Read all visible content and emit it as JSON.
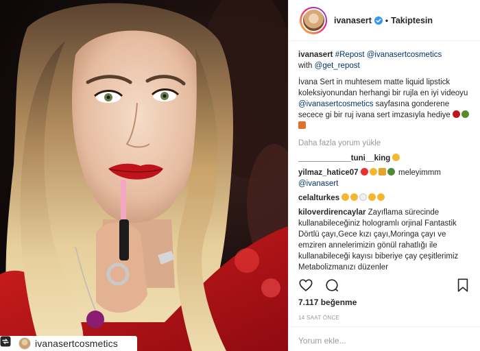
{
  "header": {
    "username": "ivanasert",
    "separator": "•",
    "follow_label": "Takiptesin"
  },
  "caption": {
    "user": "ivanasert",
    "lead": "#Repost @ivanasertcosmetics",
    "with": "with",
    "with_handle": "@get_repost",
    "text_part1": "İvana Sert in muhtesem matte liquid lipstick koleksiyonundan herhangi bir rujla en iyi videoyu",
    "text_handle": "@ivanasertcosmetics",
    "text_part2": "sayfasına gonderene secece gi bir ruj ivana sert imzasıyla hediye"
  },
  "load_more": "Daha fazla yorum yükle",
  "comments": [
    {
      "user": "____________tuni__king",
      "text": ""
    },
    {
      "user": "yilmaz_hatice07",
      "text": "meleyimmm",
      "mention": "@ivanasert"
    },
    {
      "user": "celalturkes",
      "text": ""
    },
    {
      "user": "kiloverdirencaylar",
      "text": "Zayıflama sürecinde kullanabileceğiniz hologramlı orjinal Fantastik Dörtlü çayı,Gece kızı çayı,Moringa çayı ve emziren annelerimizin gönül rahatlığı ile kullanabileceği kayısı biberiye çay çeşitlerimiz Metabolizmanızı düzenler"
    }
  ],
  "likes": "7.117 beğenme",
  "time": "14 SAAT ÖNCE",
  "add_comment_placeholder": "Yorum ekle...",
  "repost_bar": {
    "username": "ivanasertcosmetics"
  },
  "icons": {
    "verified": "verified-badge-icon",
    "like": "heart-icon",
    "comment": "comment-icon",
    "bookmark": "bookmark-icon",
    "repost": "repost-icon"
  },
  "colors": {
    "link": "#003569",
    "muted": "#999999",
    "verified": "#3897f0",
    "lips": "#c0141c"
  }
}
